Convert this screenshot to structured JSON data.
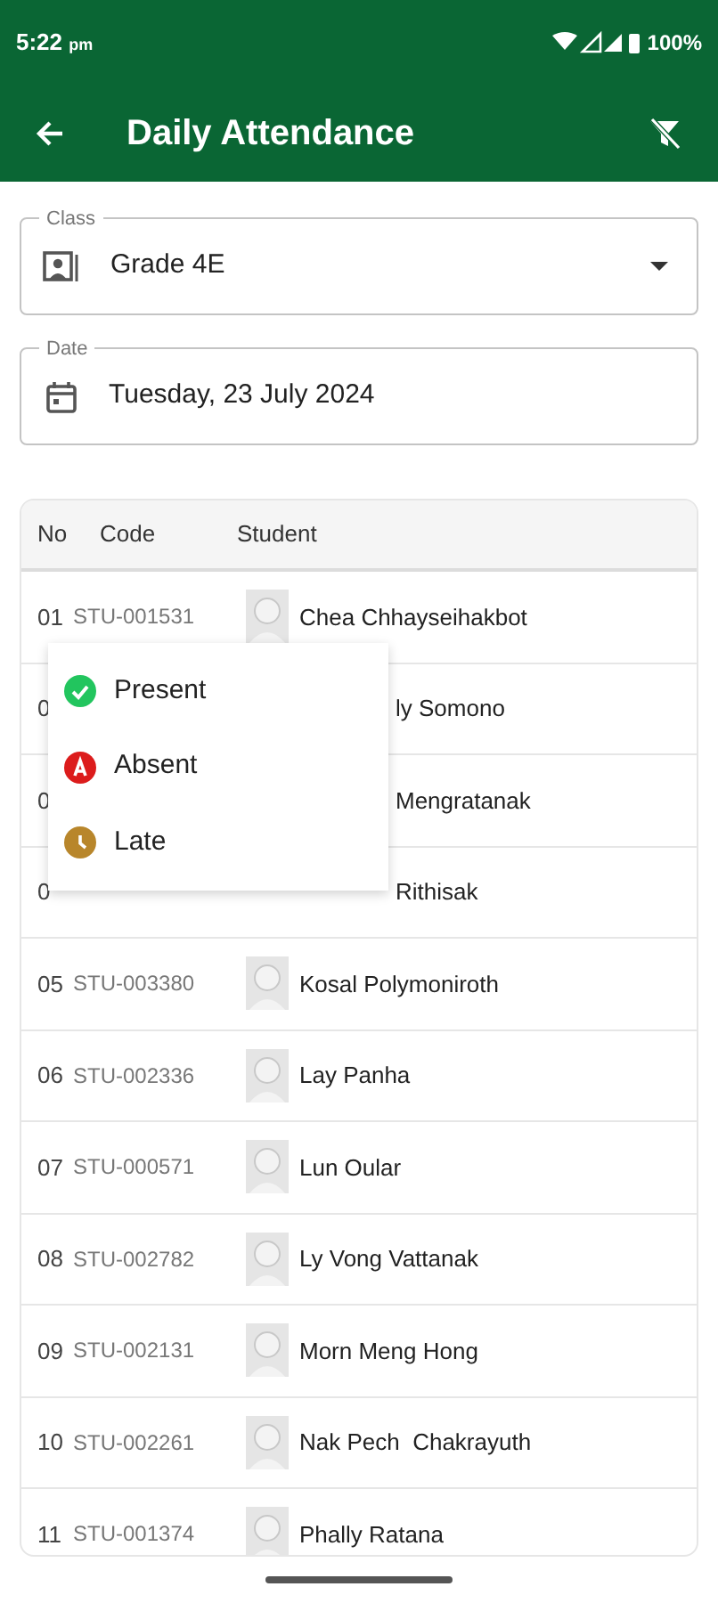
{
  "status_bar": {
    "time": "5:22",
    "ampm": "pm",
    "battery": "100%"
  },
  "app_bar": {
    "title": "Daily Attendance"
  },
  "class_field": {
    "label": "Class",
    "value": "Grade 4E"
  },
  "date_field": {
    "label": "Date",
    "value": "Tuesday, 23 July 2024"
  },
  "table": {
    "columns": [
      "No",
      "Code",
      "Student"
    ],
    "rows": [
      {
        "kind": "full",
        "no": "01",
        "code": "STU-001531",
        "student": "Chea Chhayseihakbot"
      },
      {
        "kind": "covered",
        "no": "0",
        "student": "ly Somono"
      },
      {
        "kind": "covered",
        "no": "0",
        "student": "Mengratanak"
      },
      {
        "kind": "covered",
        "no": "0",
        "student": "Rithisak"
      },
      {
        "kind": "full",
        "no": "05",
        "code": "STU-003380",
        "student": "Kosal Polymoniroth"
      },
      {
        "kind": "full",
        "no": "06",
        "code": "STU-002336",
        "student": "Lay Panha"
      },
      {
        "kind": "full",
        "no": "07",
        "code": "STU-000571",
        "student": "Lun Oular"
      },
      {
        "kind": "full",
        "no": "08",
        "code": "STU-002782",
        "student": "Ly Vong Vattanak"
      },
      {
        "kind": "full",
        "no": "09",
        "code": "STU-002131",
        "student": "Morn Meng Hong"
      },
      {
        "kind": "full",
        "no": "10",
        "code": "STU-002261",
        "student": "Nak Pech  Chakrayuth"
      },
      {
        "kind": "full",
        "no": "11",
        "code": "STU-001374",
        "student": "Phally Ratana"
      }
    ]
  },
  "status_menu": [
    {
      "kind": "present",
      "label": "Present",
      "color": "#22c55e"
    },
    {
      "kind": "absent",
      "label": "Absent",
      "color": "#dc1c1c"
    },
    {
      "kind": "late",
      "label": "Late",
      "color": "#b8862b"
    }
  ]
}
